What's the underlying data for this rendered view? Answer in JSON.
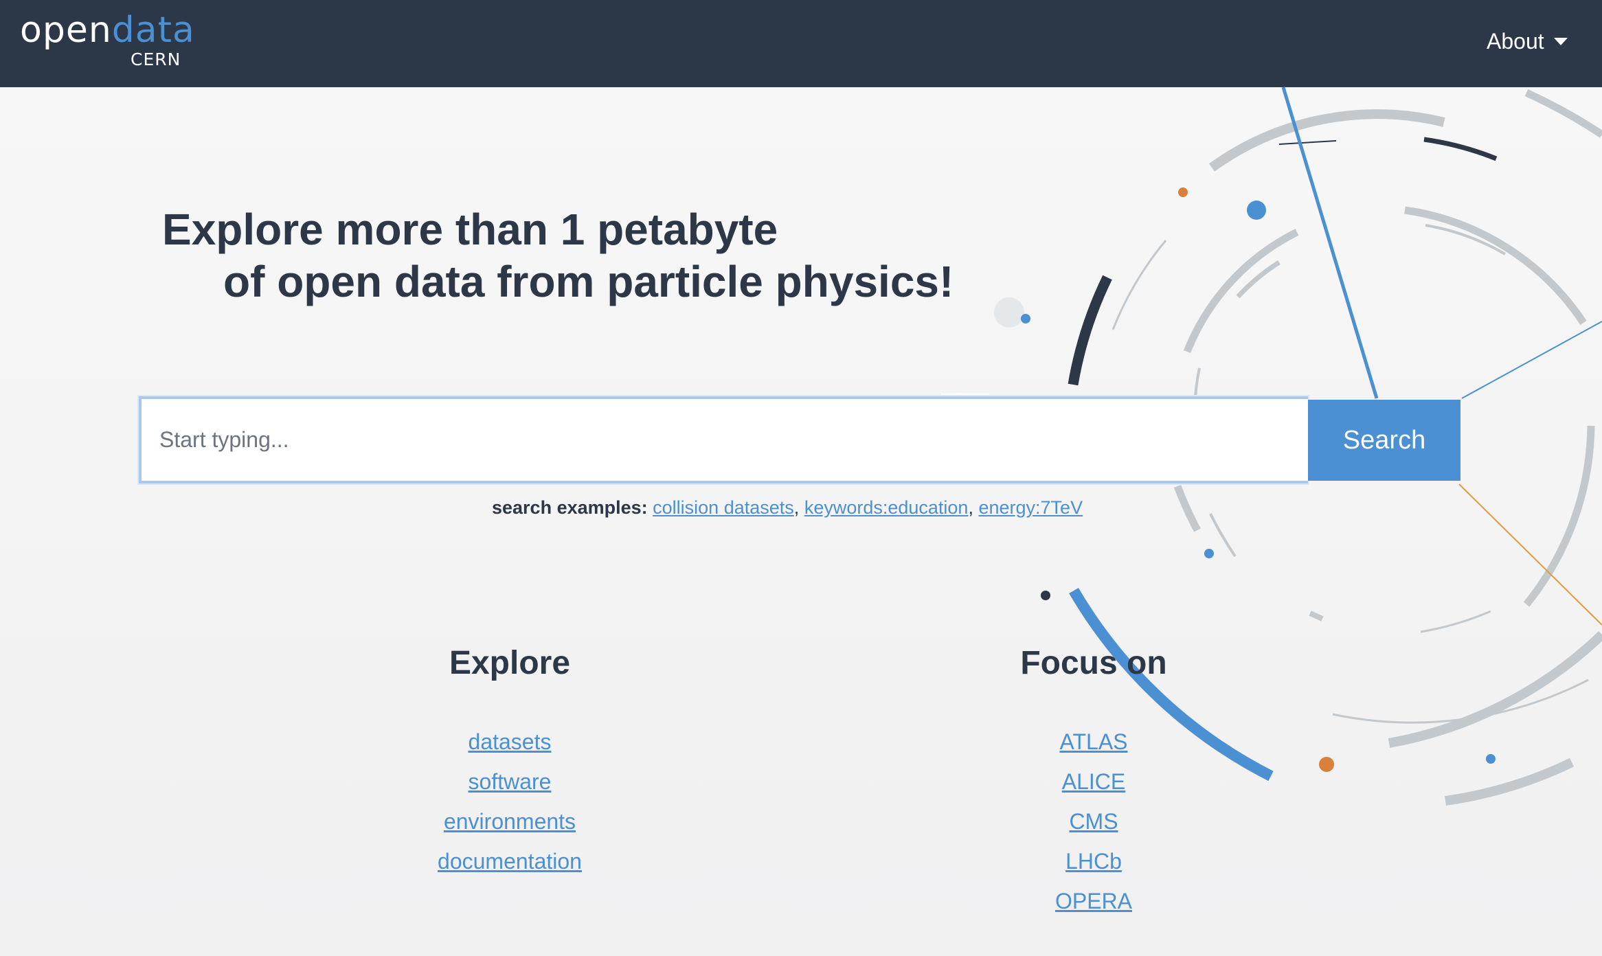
{
  "navbar": {
    "logo_main": "open",
    "logo_accent": "data",
    "logo_sub": "CERN",
    "about_label": "About"
  },
  "hero": {
    "line1_prefix": "Explore more than ",
    "line1_bold": "1 petabyte",
    "line2": "of open data from particle physics!"
  },
  "search": {
    "placeholder": "Start typing...",
    "button_label": "Search",
    "examples_label": "search examples:",
    "examples": [
      "collision datasets",
      "keywords:education",
      "energy:7TeV"
    ],
    "separator": ","
  },
  "explore": {
    "title": "Explore",
    "links": [
      "datasets",
      "software",
      "environments",
      "documentation"
    ]
  },
  "focus": {
    "title": "Focus on",
    "links": [
      "ATLAS",
      "ALICE",
      "CMS",
      "LHCb",
      "OPERA"
    ]
  },
  "colors": {
    "navbar_bg": "#2c3748",
    "accent": "#4a90d2",
    "text": "#2c3748",
    "decor_orange": "#d9813a",
    "decor_gray": "#c3c8cd"
  }
}
